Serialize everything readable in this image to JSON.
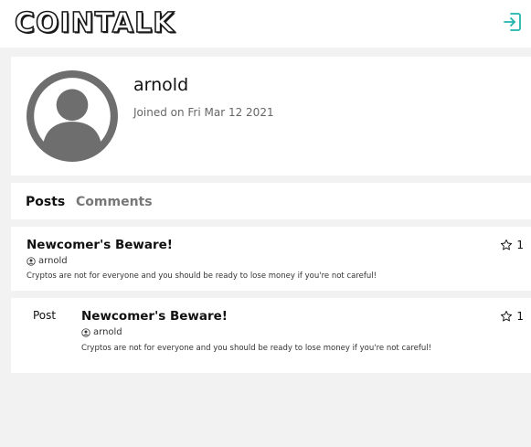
{
  "header": {
    "logo_text": "COINTALK"
  },
  "profile": {
    "username": "arnold",
    "joined": "Joined on Fri Mar 12 2021"
  },
  "tabs": {
    "posts": "Posts",
    "comments": "Comments"
  },
  "posts": [
    {
      "title": "Newcomer's Beware!",
      "author": "arnold",
      "body": "Cryptos are not for everyone and you should be ready to lose money if you're not careful!",
      "stars": "1"
    }
  ],
  "activity": [
    {
      "type_label": "Post",
      "title": "Newcomer's Beware!",
      "author": "arnold",
      "body": "Cryptos are not for everyone and you should be ready to lose money if you're not careful!",
      "stars": "1"
    }
  ],
  "icons": {
    "logout": "logout-icon",
    "avatar": "user-avatar-icon",
    "user": "user-circle-icon",
    "star": "star-icon"
  },
  "colors": {
    "accent": "#1fb5ad"
  }
}
